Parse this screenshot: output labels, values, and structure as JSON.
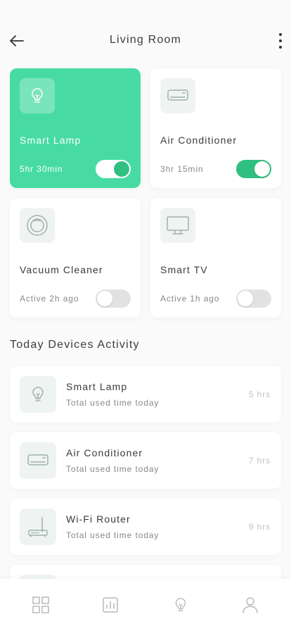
{
  "header": {
    "title": "Living Room"
  },
  "devices": [
    {
      "name": "Smart Lamp",
      "status": "5hr 30min",
      "on": true,
      "icon": "bulb-icon"
    },
    {
      "name": "Air Conditioner",
      "status": "3hr 15min",
      "on": true,
      "icon": "air-conditioner-icon"
    },
    {
      "name": "Vacuum Cleaner",
      "status": "Active 2h ago",
      "on": false,
      "icon": "robot-vacuum-icon"
    },
    {
      "name": "Smart TV",
      "status": "Active 1h ago",
      "on": false,
      "icon": "tv-icon"
    }
  ],
  "activity": {
    "title": "Today Devices Activity",
    "items": [
      {
        "name": "Smart Lamp",
        "subtitle": "Total used time today",
        "hours": "5 hrs",
        "icon": "bulb-icon"
      },
      {
        "name": "Air Conditioner",
        "subtitle": "Total used time today",
        "hours": "7 hrs",
        "icon": "air-conditioner-icon"
      },
      {
        "name": "Wi-Fi Router",
        "subtitle": "Total used time today",
        "hours": "9 hrs",
        "icon": "router-icon"
      }
    ]
  },
  "nav": [
    "grid-icon",
    "stats-icon",
    "bulb-icon",
    "user-icon"
  ],
  "colors": {
    "accent": "#47dba3",
    "toggle_on": "#2fc081",
    "icon_bg": "#eff4f2",
    "icon_stroke": "#9fb1aa"
  }
}
